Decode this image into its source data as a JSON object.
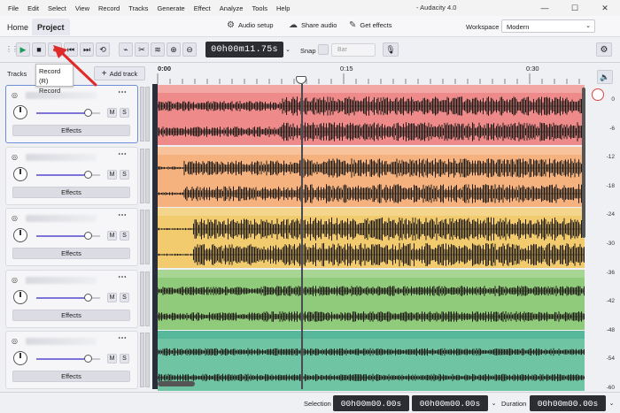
{
  "window": {
    "title": "- Audacity 4.0",
    "controls": [
      "—",
      "☐",
      "✕"
    ]
  },
  "menu": [
    "File",
    "Edit",
    "Select",
    "View",
    "Record",
    "Tracks",
    "Generate",
    "Effect",
    "Analyze",
    "Tools",
    "Help"
  ],
  "header": {
    "tabs": [
      "Home",
      "Project"
    ],
    "active_tab": "Project",
    "audio_setup": "Audio setup",
    "share_audio": "Share audio",
    "get_effects": "Get effects",
    "workspace_label": "Workspace",
    "workspace_value": "Modern"
  },
  "toolbar": {
    "time": "00h00m11.75s",
    "snap_label": "Snap",
    "snap_value": "Bar"
  },
  "tooltip": {
    "line1": "Record (R)",
    "line2": "Record"
  },
  "tracks_panel": {
    "label": "Tracks",
    "add_track": "Add track",
    "tracks": [
      {
        "mute": "M",
        "solo": "S",
        "effects": "Effects",
        "pan": 0.8,
        "color": "#ee8a8a",
        "bar": "#f3a7a4"
      },
      {
        "mute": "M",
        "solo": "S",
        "effects": "Effects",
        "pan": 0.8,
        "color": "#f5b27e",
        "bar": "#f8c29a"
      },
      {
        "mute": "M",
        "solo": "S",
        "effects": "Effects",
        "pan": 0.8,
        "color": "#f1cb6e",
        "bar": "#f4d58c"
      },
      {
        "mute": "M",
        "solo": "S",
        "effects": "Effects",
        "pan": 0.8,
        "color": "#8fcb7a",
        "bar": "#a6d594"
      },
      {
        "mute": "M",
        "solo": "S",
        "effects": "Effects",
        "pan": 0.8,
        "color": "#6fc5a3",
        "bar": "#56b79a"
      }
    ]
  },
  "timeline": {
    "ticks": [
      "0:00",
      "0:15",
      "0:30"
    ]
  },
  "meter": {
    "scale": [
      "0",
      "-6",
      "-12",
      "-18",
      "-24",
      "-30",
      "-36",
      "-42",
      "-48",
      "-54",
      "-60"
    ]
  },
  "bottom": {
    "selection_label": "Selection",
    "selection_start": "00h00m00.00s",
    "selection_end": "00h00m00.00s",
    "duration_label": "Duration",
    "duration": "00h00m00.00s"
  },
  "icons": {
    "play": "play-icon",
    "stop": "stop-icon",
    "record": "record-icon",
    "skip_start": "skip-start-icon",
    "loop": "loop-icon"
  }
}
